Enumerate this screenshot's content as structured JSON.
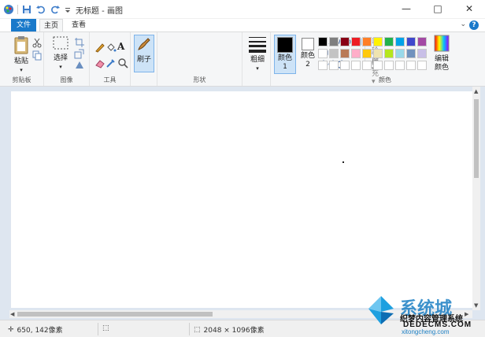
{
  "app": {
    "title": "无标题 - 画图"
  },
  "window_controls": {
    "minimize": "—",
    "maximize": "□",
    "close": "✕"
  },
  "tabs": {
    "file": "文件",
    "home": "主页",
    "view": "查看"
  },
  "ribbon": {
    "clipboard": {
      "paste": "粘贴",
      "label": "剪贴板"
    },
    "image": {
      "select": "选择",
      "label": "图像"
    },
    "tools": {
      "text_glyph": "A",
      "label": "工具"
    },
    "brushes": {
      "label": "刷子"
    },
    "shapes": {
      "outline": "轮廓",
      "fill": "填充",
      "label": "形状"
    },
    "size": {
      "label": "粗细"
    },
    "color1": {
      "label": "颜色 1"
    },
    "color2": {
      "label": "颜色 2"
    },
    "colors": {
      "label": "颜色",
      "edit": "编辑颜色"
    },
    "palette_row1": [
      "#000000",
      "#7f7f7f",
      "#880015",
      "#ed1c24",
      "#ff7f27",
      "#fff200",
      "#22b14c",
      "#00a2e8",
      "#3f48cc",
      "#a349a4"
    ],
    "palette_row2": [
      "#ffffff",
      "#c3c3c3",
      "#b97a57",
      "#ffaec9",
      "#ffc90e",
      "#efe4b0",
      "#b5e61d",
      "#99d9ea",
      "#7092be",
      "#c8bfe7"
    ]
  },
  "status": {
    "cursor": "650, 142像素",
    "canvas_size": "2048 × 1096像素"
  },
  "watermark": {
    "brand": "系统城",
    "site1": "织梦内容管理系统",
    "site2": "DEDECMS.COM",
    "site3": "xitongcheng.com"
  }
}
